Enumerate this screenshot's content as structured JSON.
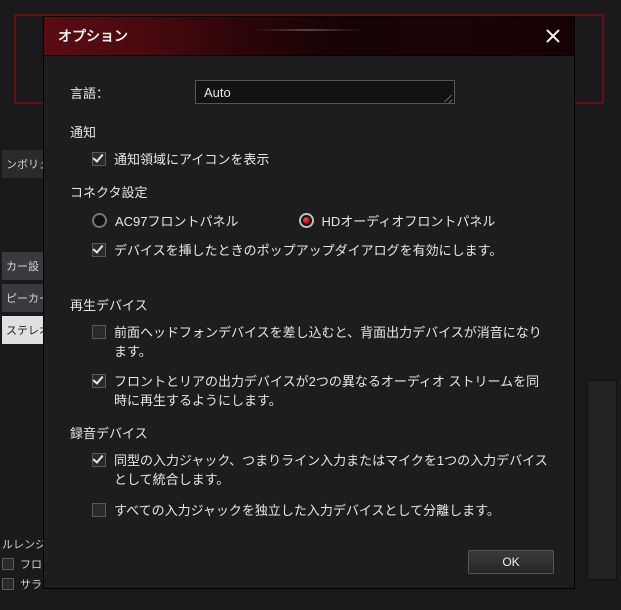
{
  "bg": {
    "tabs": [
      "ンボリ",
      "カー設",
      "ピーカー",
      "ステレオ"
    ],
    "volume_label": "ンボリュ",
    "bottom_label": "ルレンジ",
    "bottom_checks": [
      "フロン",
      "サラ"
    ]
  },
  "dialog": {
    "title": "オプション",
    "ok_label": "OK"
  },
  "lang": {
    "label": "言語：",
    "value": "Auto"
  },
  "notice": {
    "section": "通知",
    "show_tray": {
      "label": "通知領域にアイコンを表示",
      "checked": true
    }
  },
  "connector": {
    "section": "コネクタ設定",
    "radios": {
      "ac97": {
        "label": "AC97フロントパネル",
        "selected": false
      },
      "hd": {
        "label": "HDオーディオフロントパネル",
        "selected": true
      }
    },
    "popup": {
      "label": "デバイスを挿したときのポップアップダイアログを有効にします。",
      "checked": true
    }
  },
  "playback": {
    "section": "再生デバイス",
    "mute_rear": {
      "label": "前面ヘッドフォンデバイスを差し込むと、背面出力デバイスが消音になります。",
      "checked": false
    },
    "dual_stream": {
      "label": "フロントとリアの出力デバイスが2つの異なるオーディオ ストリームを同時に再生するようにします。",
      "checked": true
    }
  },
  "recording": {
    "section": "録音デバイス",
    "merge": {
      "label": "同型の入力ジャック、つまりライン入力またはマイクを1つの入力デバイスとして統合します。",
      "checked": true
    },
    "split": {
      "label": "すべての入力ジャックを独立した入力デバイスとして分離します。",
      "checked": false
    }
  }
}
